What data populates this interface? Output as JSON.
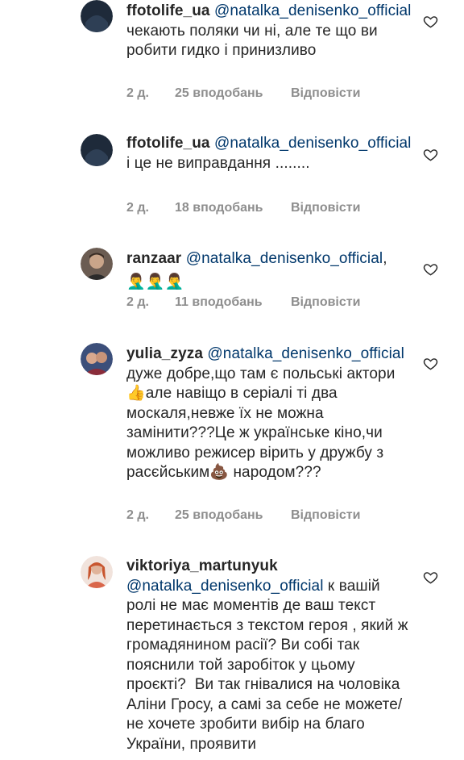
{
  "comments": [
    {
      "username": "ffotolife_ua",
      "mention": "@natalka_denisenko_official",
      "text": "чекають поляки чи ні, але те що ви робити гидко і принизливо",
      "age": "2 д.",
      "likes": "25 вподобань",
      "reply": "Відповісти"
    },
    {
      "username": "ffotolife_ua",
      "mention": "@natalka_denisenko_official",
      "text": "і це не виправдання ........",
      "age": "2 д.",
      "likes": "18 вподобань",
      "reply": "Відповісти"
    },
    {
      "username": "ranzaar",
      "mention": "@natalka_denisenko_official",
      "text": ",",
      "emoji": "🤦‍♂️🤦‍♂️🤦‍♂️",
      "age": "2 д.",
      "likes": "11 вподобань",
      "reply": "Відповісти"
    },
    {
      "username": "yulia_zyza",
      "mention": "@natalka_denisenko_official",
      "text": "дуже добре,що там є польські актори👍але навіщо в серіалі ті два москаля,невже їх не можна замінити???Це ж українське кіно,чи можливо режисер вірить у дружбу з расєйським💩 народом???",
      "age": "2 д.",
      "likes": "25 вподобань",
      "reply": "Відповісти"
    },
    {
      "username": "viktoriya_martunyuk",
      "mention": "@natalka_denisenko_official",
      "text": "к вашій ролі не має моментів де ваш текст перетинається з текстом героя , який ж громадянином расії? Ви собі так пояснили той заробіток у цьому проєкті?  Ви так гнівалися на чоловіка Аліни Гросу, а самі за себе не можете/не хочете зробити вибір на благо України, проявити"
    }
  ],
  "colors": {
    "text": "#262626",
    "mention": "#00376b",
    "meta": "#8e8e8e"
  },
  "icons": {
    "like": "heart-outline-icon"
  }
}
